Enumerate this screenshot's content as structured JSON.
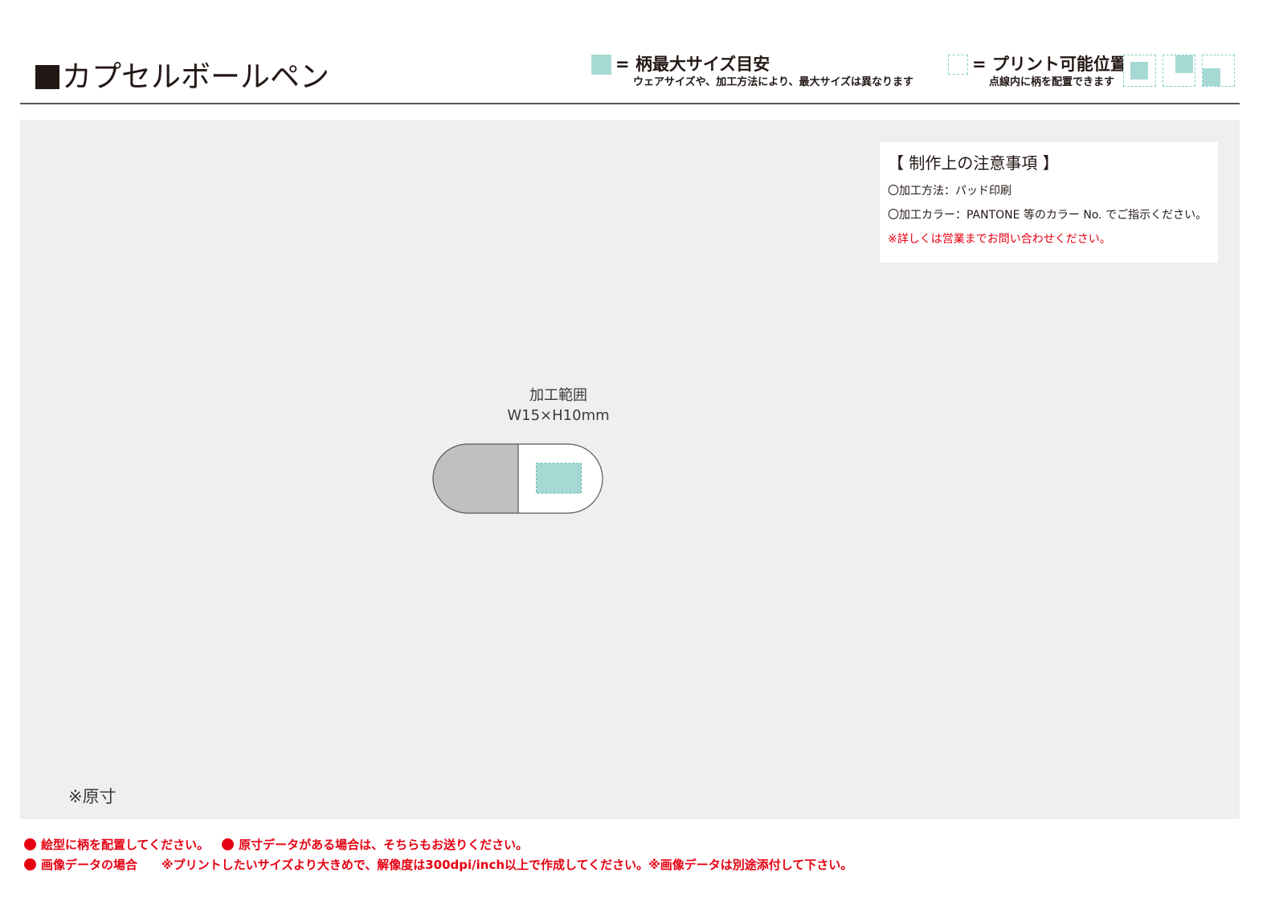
{
  "header": {
    "title": "カプセルボールペン",
    "legend_max": {
      "title": "= 柄最大サイズ目安",
      "sub": "ウェアサイズや、加工方法により、最大サイズは異なります"
    },
    "legend_print": {
      "title": "= プリント可能位置",
      "sub": "点線内に柄を配置できます"
    }
  },
  "notes": {
    "title": "【 制作上の注意事項 】",
    "method": "〇加工方法：パッド印刷",
    "color": "〇加工カラー：PANTONE 等のカラー No. でご指示ください。",
    "warning": "※詳しくは営業までお問い合わせください。"
  },
  "print_area": {
    "label": "加工範囲",
    "size": "W15×H10mm"
  },
  "scale_note": "※原寸",
  "footer": {
    "line1_a": "絵型に柄を配置してください。",
    "line1_b": "原寸データがある場合は、そちらもお送りください。",
    "line2_a": "画像データの場合",
    "line2_b": "※プリントしたいサイズより大きめで、解像度は300dpi/inch以上で作成してください。※画像データは別途添付して下さい。"
  },
  "colors": {
    "accent_teal": "#a7d9d4",
    "dashed_teal": "#7fcfc8",
    "warning_red": "#e60012",
    "canvas_gray": "#eeefef",
    "pen_gray": "#bfc0c2"
  }
}
